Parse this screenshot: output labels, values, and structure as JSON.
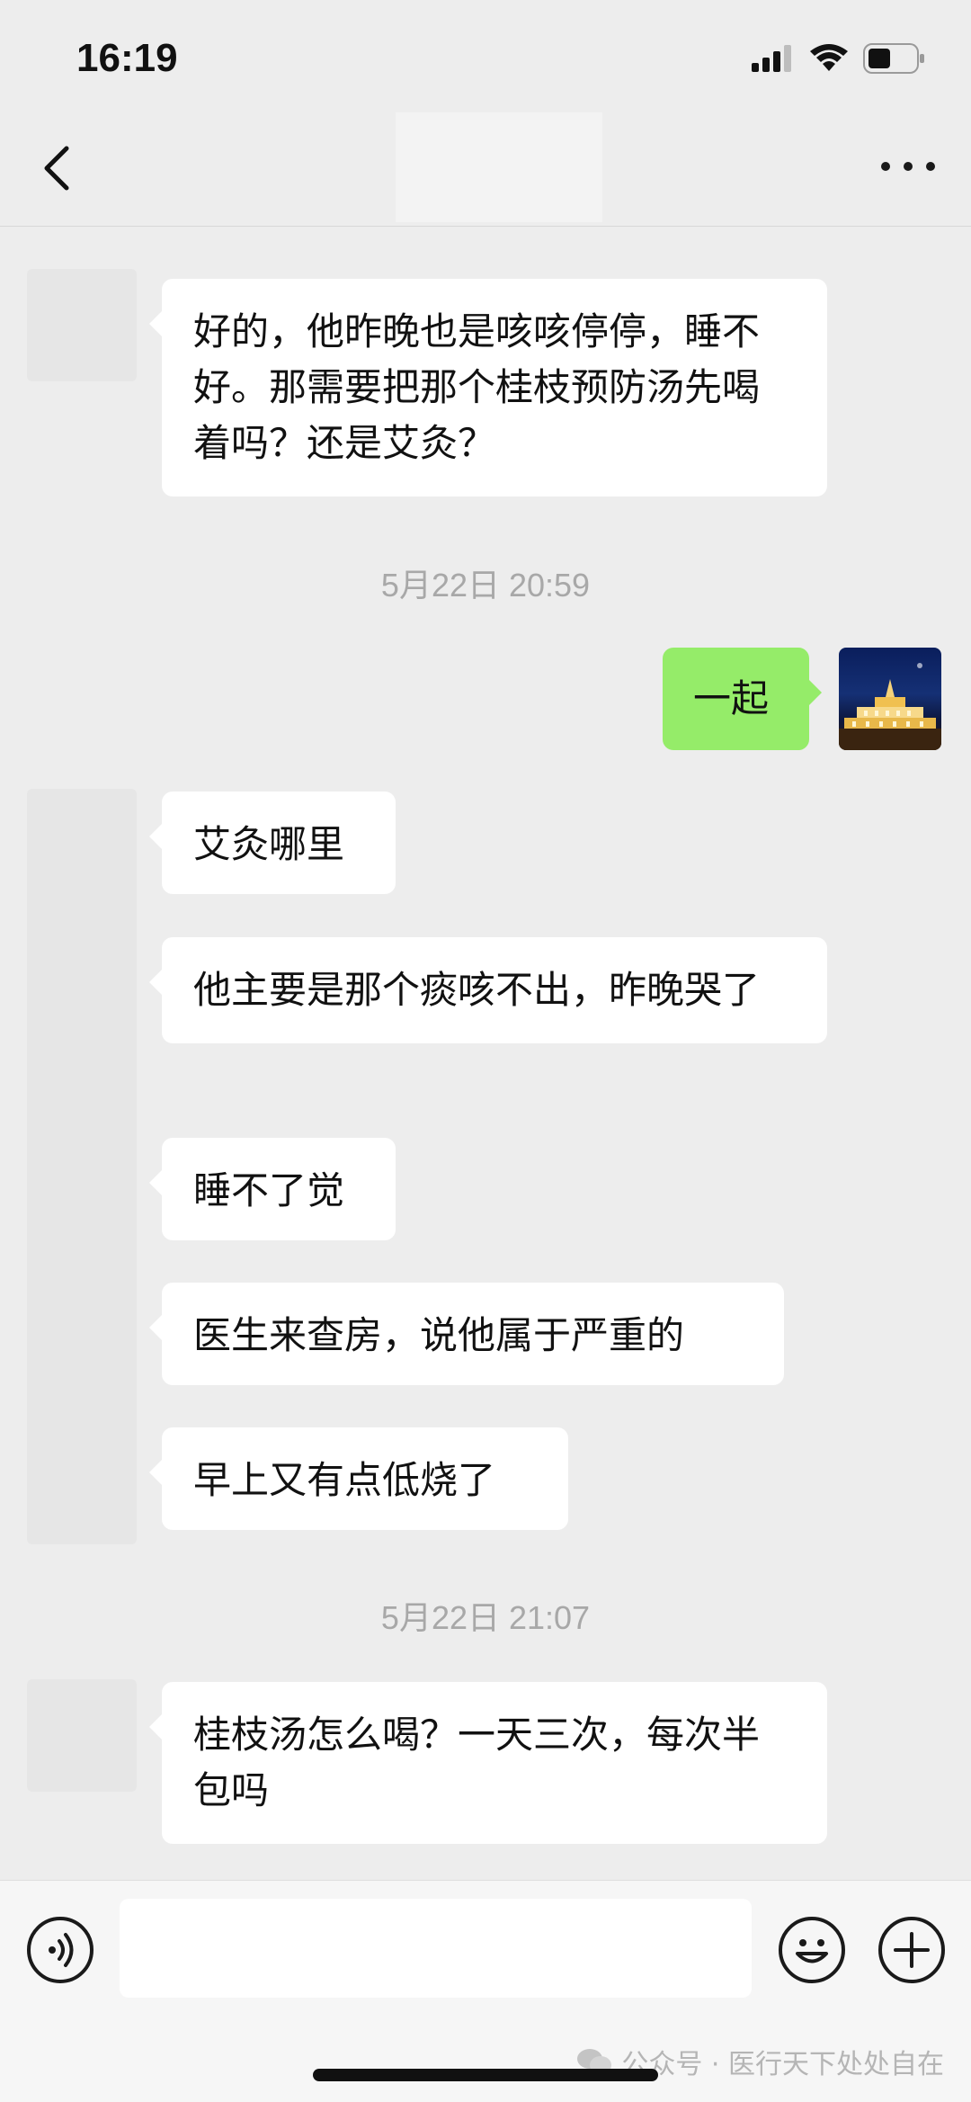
{
  "status_bar": {
    "time": "16:19"
  },
  "chat": {
    "messages": [
      {
        "side": "left",
        "text": "好的，他昨晚也是咳咳停停，睡不好。那需要把那个桂枝预防汤先喝着吗？还是艾灸？"
      },
      {
        "type": "timestamp",
        "text": "5月22日 20:59"
      },
      {
        "side": "right",
        "text": "一起"
      },
      {
        "side": "left",
        "text": "艾灸哪里"
      },
      {
        "side": "left",
        "text": "他主要是那个痰咳不出，昨晚哭了"
      },
      {
        "side": "left",
        "text": "睡不了觉"
      },
      {
        "side": "left",
        "text": "医生来查房，说他属于严重的"
      },
      {
        "side": "left",
        "text": "早上又有点低烧了"
      },
      {
        "type": "timestamp",
        "text": "5月22日 21:07"
      },
      {
        "side": "left",
        "text": "桂枝汤怎么喝？一天三次，每次半包吗"
      }
    ]
  },
  "input_bar": {
    "value": "",
    "placeholder": ""
  },
  "watermark": {
    "text": "公众号 · 医行天下处处自在"
  },
  "colors": {
    "background": "#ededed",
    "bubble_left": "#ffffff",
    "bubble_right": "#95ec69"
  }
}
